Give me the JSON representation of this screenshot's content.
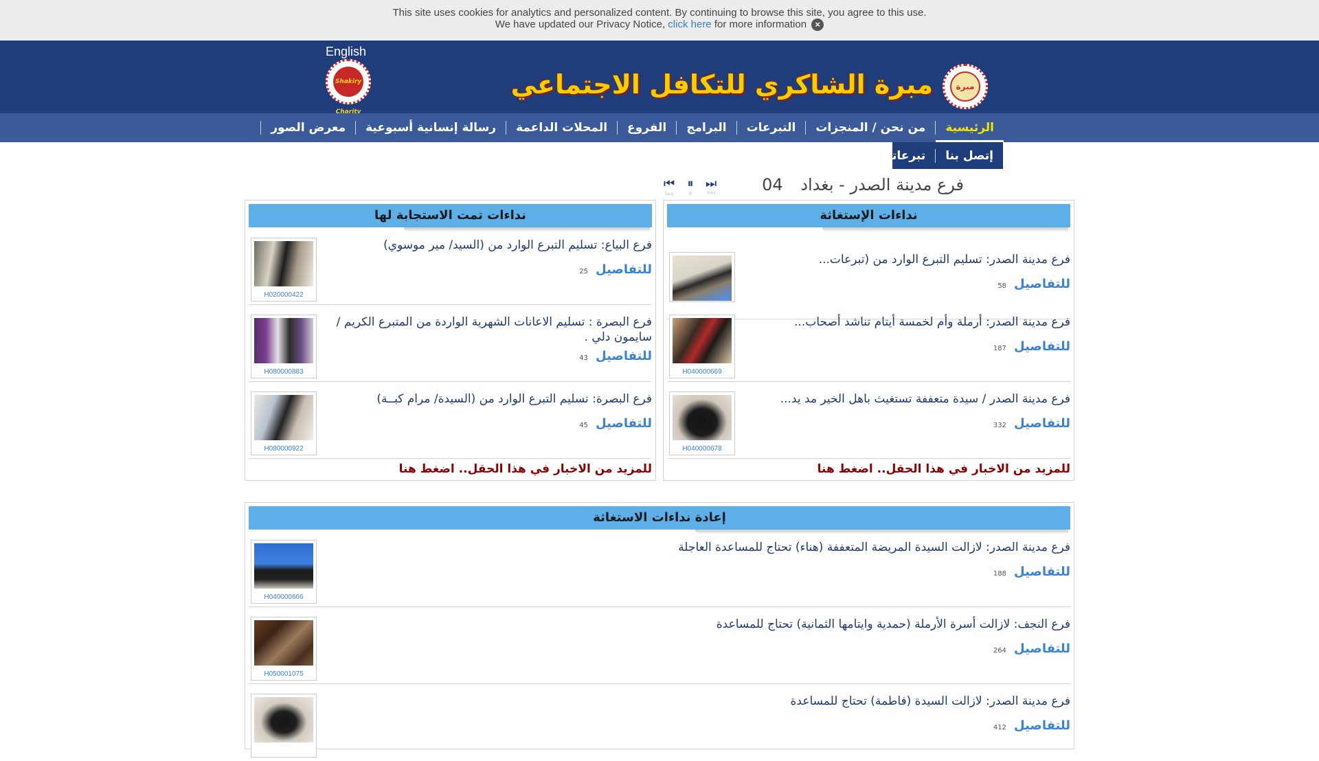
{
  "cookie": {
    "line1": "This site uses cookies for analytics and personalized content. By continuing to browse this site, you agree to this use.",
    "line2_before": "We have updated our Privacy Notice,",
    "link": "click here",
    "line2_after": "for more information",
    "close_icon": "close-icon"
  },
  "header": {
    "language": "English",
    "brand": "مبرة الشاكري للتكافل الاجتماعي",
    "small_logo_text": "Shakiry Charity",
    "big_logo_text": "مبرة"
  },
  "nav": {
    "items": [
      "الرئيسية",
      "من نحن / المنجزات",
      "التبرعات",
      "البرامج",
      "الفروع",
      "المحلات الداعمة",
      "رسالة إنسانية أسبوعية",
      "معرض الصور"
    ],
    "sub_items": [
      "إتصل بنا",
      "تبرعاتك"
    ]
  },
  "ticker": {
    "text": "فرع مدينة الصدر - بغداد",
    "number": "04",
    "controls": [
      "prev-icon",
      "pause-icon",
      "next-icon"
    ]
  },
  "appeals": {
    "title": "نداءات الإستغاثة",
    "items": [
      {
        "title": "فرع مدينة الصدر: تسليم التبرع الوارد من (تبرعات...",
        "details": "للتفاصيل",
        "count": "58",
        "code": ""
      },
      {
        "title": "فرع مدينة الصدر: أرملة وأم لخمسة أيتام تناشد أصحاب...",
        "details": "للتفاصيل",
        "count": "187",
        "code": "H040000669"
      },
      {
        "title": "فرع مدينة الصدر / سيدة متعففة تستغيث باهل الخير مد يد...",
        "details": "للتفاصيل",
        "count": "332",
        "code": "H040000678"
      }
    ],
    "more": "للمزيد من الاخبار في هذا الحقل.. اضغط هنا"
  },
  "responded": {
    "title": "نداءات تمت الاستجابة لها",
    "items": [
      {
        "title": "فرع البياع: تسليم التبرع الوارد من (السيد/ مير موسوي)",
        "details": "للتفاصيل",
        "count": "25",
        "code": "H020000422"
      },
      {
        "title": "فرع البصرة : تسليم الاعانات الشهرية الواردة من المتبرع الكريم / سايمون دلي .",
        "details": "للتفاصيل",
        "count": "43",
        "code": "H080000883"
      },
      {
        "title": "فرع البصرة: تسليم التبرع الوارد من (السيدة/ مرام كبــة)",
        "details": "للتفاصيل",
        "count": "45",
        "code": "H080000922"
      }
    ],
    "more": "للمزيد من الاخبار في هذا الحقل.. اضغط هنا"
  },
  "reappeals": {
    "title": "إعادة نداءات الاستغاثة",
    "items": [
      {
        "title": "فرع مدينة الصدر: لازالت السيدة المريضة المتعففة (هناء) تحتاج للمساعدة العاجلة",
        "details": "للتفاصيل",
        "count": "188",
        "code": "H040000666"
      },
      {
        "title": "فرع النجف: لازالت أسرة الأرملة (حمدية وايتامها الثمانية) تحتاج للمساعدة",
        "details": "للتفاصيل",
        "count": "264",
        "code": "H050001075"
      },
      {
        "title": "فرع مدينة الصدر: لازالت السيدة (فاطمة) تحتاج للمساعدة",
        "details": "للتفاصيل",
        "count": "412",
        "code": ""
      }
    ]
  }
}
